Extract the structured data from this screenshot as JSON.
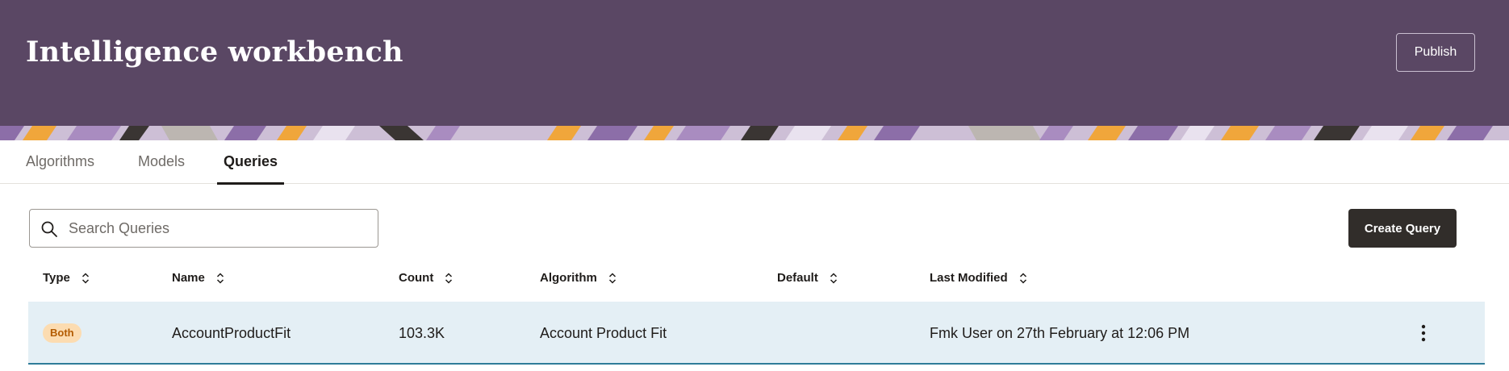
{
  "header": {
    "title": "Intelligence workbench",
    "publish_label": "Publish",
    "background_color": "#5a4764"
  },
  "tabs": [
    {
      "label": "Algorithms",
      "active": false
    },
    {
      "label": "Models",
      "active": false
    },
    {
      "label": "Queries",
      "active": true
    }
  ],
  "search": {
    "placeholder": "Search Queries",
    "value": ""
  },
  "create_button": {
    "label": "Create Query"
  },
  "table": {
    "columns": [
      "Type",
      "Name",
      "Count",
      "Algorithm",
      "Default",
      "Last Modified"
    ],
    "rows": [
      {
        "type": "Both",
        "name": "AccountProductFit",
        "count": "103.3K",
        "algorithm": "Account Product Fit",
        "default": "",
        "last_modified": "Fmk User on 27th February at 12:06 PM",
        "selected": true
      }
    ]
  },
  "icons": {
    "search": "search-icon",
    "sort": "sort-icon",
    "more_actions": "more-vertical-icon"
  },
  "colors": {
    "accent_dark": "#312d2a",
    "row_selected": "#e4eff5",
    "badge_bg": "#fcdcb1",
    "badge_text": "#b35b00"
  }
}
